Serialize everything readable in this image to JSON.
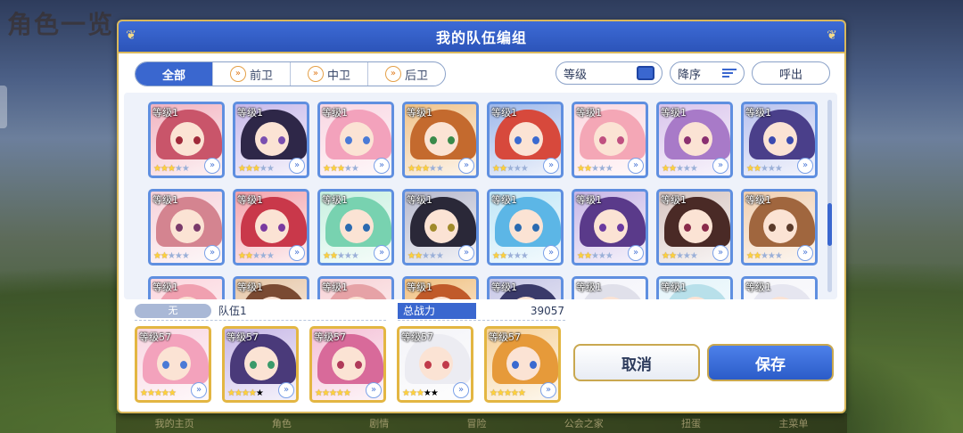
{
  "background": {
    "title": "角色一览",
    "nav": [
      "我的主页",
      "角色",
      "剧情",
      "冒险",
      "公会之家",
      "扭蛋",
      "主菜单"
    ]
  },
  "dialog": {
    "title": "我的队伍编组",
    "tabs": [
      {
        "label": "全部",
        "active": true,
        "icon": ""
      },
      {
        "label": "前卫",
        "active": false,
        "icon": "front-role-icon"
      },
      {
        "label": "中卫",
        "active": false,
        "icon": "middle-role-icon"
      },
      {
        "label": "后卫",
        "active": false,
        "icon": "back-role-icon"
      }
    ],
    "sort": {
      "level_label": "等级",
      "order_label": "降序",
      "call_label": "呼出"
    },
    "roster": [
      {
        "level": "等级1",
        "stars": 3,
        "hair": "#c9556a",
        "eye": "#a02a3a",
        "bg": "#f2b3c0"
      },
      {
        "level": "等级1",
        "stars": 3,
        "hair": "#2e2748",
        "eye": "#7a4fb0",
        "bg": "#c7b8ea"
      },
      {
        "level": "等级1",
        "stars": 3,
        "hair": "#f3a2bc",
        "eye": "#4a7ad6",
        "bg": "#f9d6e2"
      },
      {
        "level": "等级1",
        "stars": 3,
        "hair": "#c46a2e",
        "eye": "#3a8a4a",
        "bg": "#f0c38a"
      },
      {
        "level": "等级1",
        "stars": 2,
        "hair": "#d7493c",
        "eye": "#3a6ad0",
        "bg": "#9fb8ea"
      },
      {
        "level": "等级1",
        "stars": 2,
        "hair": "#f4a7b6",
        "eye": "#c05080",
        "bg": "#fbd8e0"
      },
      {
        "level": "等级1",
        "stars": 2,
        "hair": "#a87ac8",
        "eye": "#8a3070",
        "bg": "#d9c4ec"
      },
      {
        "level": "等级1",
        "stars": 2,
        "hair": "#4a3f8a",
        "eye": "#3a4ab0",
        "bg": "#b9c2ee"
      },
      {
        "level": "等级1",
        "stars": 2,
        "hair": "#d48490",
        "eye": "#7a3a6a",
        "bg": "#f6d2da"
      },
      {
        "level": "等级1",
        "stars": 2,
        "hair": "#c9384a",
        "eye": "#7a3aa0",
        "bg": "#f3a3ac"
      },
      {
        "level": "等级1",
        "stars": 2,
        "hair": "#78d2b0",
        "eye": "#2a6ab0",
        "bg": "#c8f0e0"
      },
      {
        "level": "等级1",
        "stars": 2,
        "hair": "#2a2838",
        "eye": "#a08a2a",
        "bg": "#b6b8cc"
      },
      {
        "level": "等级1",
        "stars": 2,
        "hair": "#5cb6e6",
        "eye": "#2a6ab0",
        "bg": "#bfe6f7"
      },
      {
        "level": "等级1",
        "stars": 2,
        "hair": "#5a3a8a",
        "eye": "#6a3aa0",
        "bg": "#c8b6e6"
      },
      {
        "level": "等级1",
        "stars": 2,
        "hair": "#4a2a26",
        "eye": "#8a2a4a",
        "bg": "#d6c4c0"
      },
      {
        "level": "等级1",
        "stars": 2,
        "hair": "#a0663e",
        "eye": "#5a3a2a",
        "bg": "#f0cfb0"
      },
      {
        "level": "等级1",
        "stars": 0,
        "hair": "#f0a0b0",
        "eye": "#8a3a5a",
        "bg": "#fbd6de"
      },
      {
        "level": "等级1",
        "stars": 0,
        "hair": "#7a4a32",
        "eye": "#5a3a2a",
        "bg": "#e6c6a6"
      },
      {
        "level": "等级1",
        "stars": 0,
        "hair": "#e6a2a6",
        "eye": "#7a3a5a",
        "bg": "#f7d2d6"
      },
      {
        "level": "等级1",
        "stars": 0,
        "hair": "#c05a2a",
        "eye": "#5a3a2a",
        "bg": "#f0c080"
      },
      {
        "level": "等级1",
        "stars": 0,
        "hair": "#3a3a6a",
        "eye": "#3a3a8a",
        "bg": "#c6c6e6"
      },
      {
        "level": "等级1",
        "stars": 0,
        "hair": "#e0e0ea",
        "eye": "#6a6a8a",
        "bg": "#f4f4fa"
      },
      {
        "level": "等级1",
        "stars": 0,
        "hair": "#b8e0ea",
        "eye": "#3a7ab0",
        "bg": "#e4f4fa"
      },
      {
        "level": "等级1",
        "stars": 0,
        "hair": "#e6e6f0",
        "eye": "#8a6a8a",
        "bg": "#f6f6fa"
      }
    ],
    "team": {
      "badge": "无",
      "name": "队伍1",
      "power_label": "总战力",
      "power_value": "39057"
    },
    "party": [
      {
        "level": "等级57",
        "stars": 5,
        "hair": "#f3a2bc",
        "eye": "#4a7ad6",
        "bg": "#f9d6e2"
      },
      {
        "level": "等级57",
        "stars": 4,
        "hair": "#4a3a7a",
        "eye": "#3a9a6a",
        "bg": "#c6b6e6"
      },
      {
        "level": "等级57",
        "stars": 5,
        "hair": "#d86a9a",
        "eye": "#b03a5a",
        "bg": "#f4c0d6"
      },
      {
        "level": "等级57",
        "stars": 3,
        "hair": "#ececf2",
        "eye": "#c03a4a",
        "bg": "#f4f4f8"
      },
      {
        "level": "等级57",
        "stars": 5,
        "hair": "#e69a3a",
        "eye": "#3a6ad0",
        "bg": "#f6d29a"
      }
    ],
    "buttons": {
      "cancel": "取消",
      "save": "保存"
    },
    "colors": {
      "header": "#2c54b9",
      "accent": "#3a67cf",
      "gold_border": "#d9b85c"
    }
  }
}
